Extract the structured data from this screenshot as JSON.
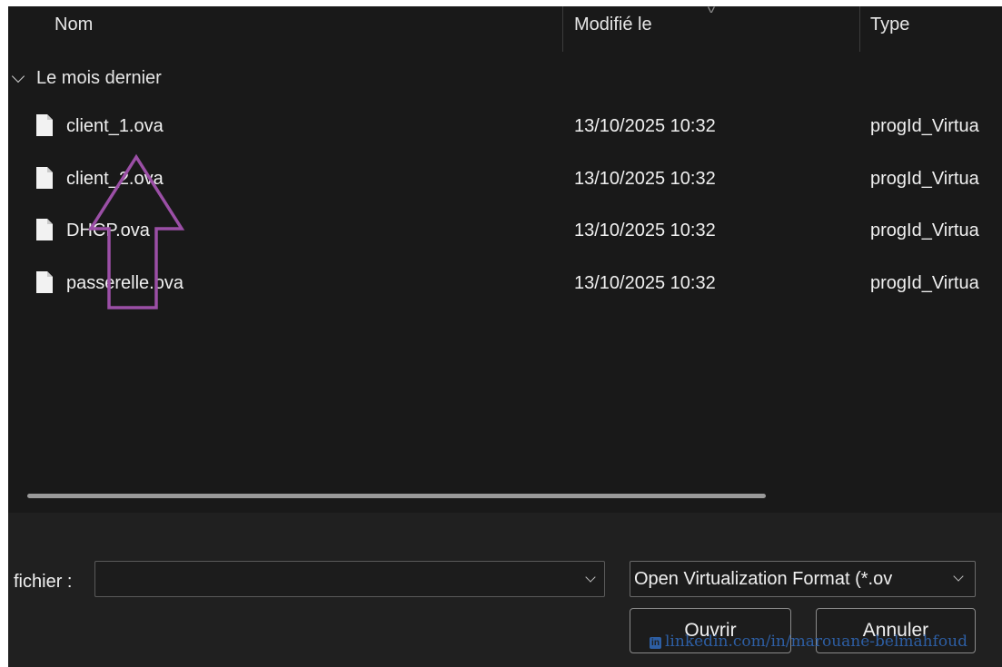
{
  "columns": {
    "name": "Nom",
    "modified": "Modifié le",
    "type": "Type"
  },
  "group": {
    "label": "Le mois dernier"
  },
  "files": [
    {
      "name": "client_1.ova",
      "modified": "13/10/2025 10:32",
      "type": "progId_Virtua"
    },
    {
      "name": "client_2.ova",
      "modified": "13/10/2025 10:32",
      "type": "progId_Virtua"
    },
    {
      "name": "DHCP.ova",
      "modified": "13/10/2025 10:32",
      "type": "progId_Virtua"
    },
    {
      "name": "passerelle.ova",
      "modified": "13/10/2025 10:32",
      "type": "progId_Virtua"
    }
  ],
  "footer": {
    "filename_label": "fichier :",
    "filename_value": "",
    "file_type_value": "Open Virtualization Format (*.ov",
    "open_label": "Ouvrir",
    "cancel_label": "Annuler"
  },
  "watermark": {
    "icon_text": "in",
    "text": "linkedin.com/in/marouane-belmahfoud"
  },
  "colors": {
    "background": "#191919",
    "footer": "#202020",
    "annotation_arrow": "#9b4fa6",
    "watermark": "#2d5ea3"
  },
  "icons": {
    "group_toggle": "chevron-down-icon",
    "file": "file-icon",
    "dropdown": "chevron-down-icon",
    "annotation": "arrow-up-annotation"
  }
}
